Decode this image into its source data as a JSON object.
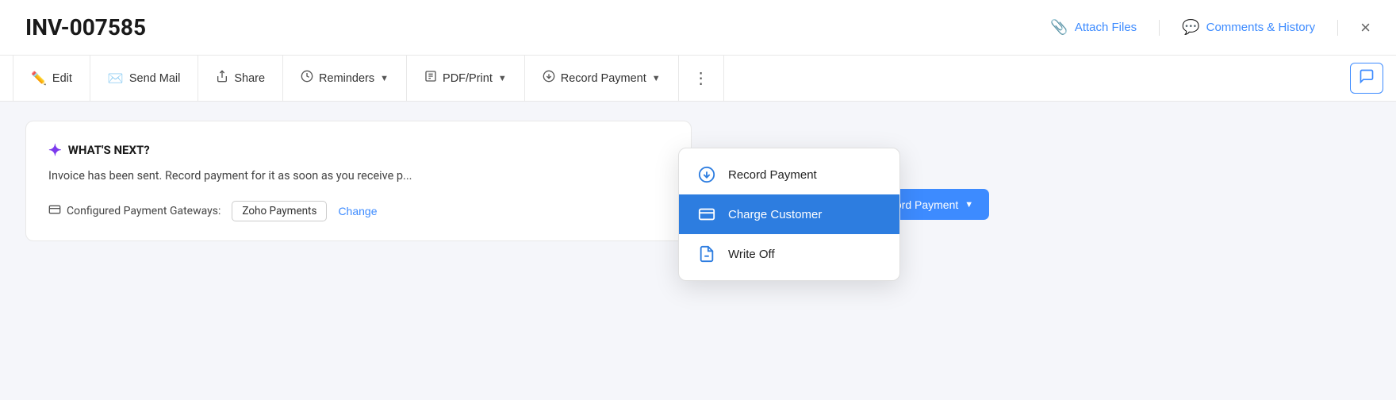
{
  "header": {
    "title": "INV-007585",
    "attach_files_label": "Attach Files",
    "comments_history_label": "Comments & History",
    "close_label": "×"
  },
  "toolbar": {
    "edit_label": "Edit",
    "send_mail_label": "Send Mail",
    "share_label": "Share",
    "reminders_label": "Reminders",
    "pdf_print_label": "PDF/Print",
    "record_payment_label": "Record Payment",
    "more_icon": "⋮"
  },
  "dropdown": {
    "items": [
      {
        "id": "record-payment",
        "label": "Record Payment",
        "icon": "download-circle"
      },
      {
        "id": "charge-customer",
        "label": "Charge Customer",
        "icon": "charge",
        "active": true
      },
      {
        "id": "write-off",
        "label": "Write Off",
        "icon": "write-off"
      }
    ]
  },
  "whats_next": {
    "title": "WHAT'S NEXT?",
    "body": "Invoice has been sent. Record payment for it as soon as you receive p...",
    "gateway_label": "Configured Payment Gateways:",
    "gateway_name": "Zoho Payments",
    "change_label": "Change",
    "record_payment_btn": "Record Payment"
  }
}
